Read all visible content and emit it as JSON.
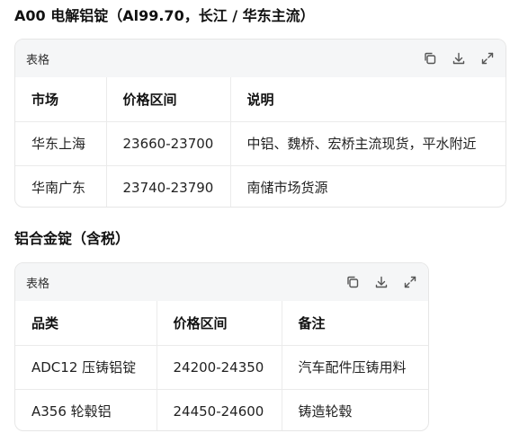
{
  "section1": {
    "heading": "A00 电解铝锭（Al99.70，长江 / 华东主流）",
    "toolbar_label": "表格",
    "headers": [
      "市场",
      "价格区间",
      "说明"
    ],
    "rows": [
      [
        "华东上海",
        "23660-23700",
        "中铝、魏桥、宏桥主流现货，平水附近"
      ],
      [
        "华南广东",
        "23740-23790",
        "南储市场货源"
      ]
    ]
  },
  "section2": {
    "heading": "铝合金锭（含税）",
    "toolbar_label": "表格",
    "headers": [
      "品类",
      "价格区间",
      "备注"
    ],
    "rows": [
      [
        "ADC12 压铸铝锭",
        "24200-24350",
        "汽车配件压铸用料"
      ],
      [
        "A356 轮毂铝",
        "24450-24600",
        "铸造轮毂"
      ]
    ]
  },
  "icons": {
    "copy": "copy-icon",
    "download": "download-icon",
    "expand": "expand-icon"
  }
}
